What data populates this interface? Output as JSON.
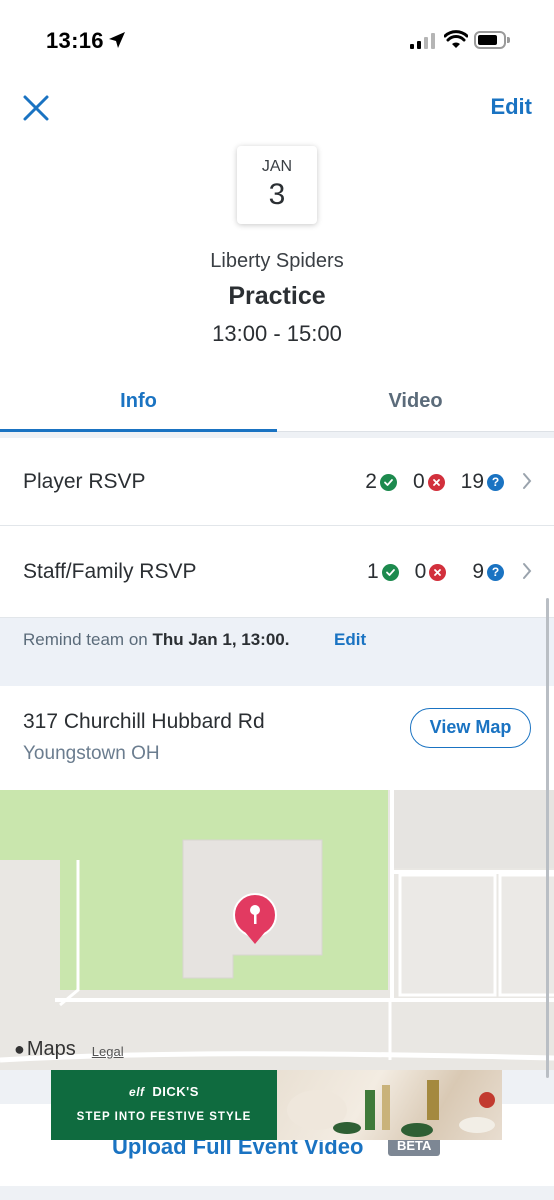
{
  "status_bar": {
    "time": "13:16"
  },
  "nav": {
    "edit_label": "Edit"
  },
  "event": {
    "month": "JAN",
    "day": "3",
    "team": "Liberty Spiders",
    "type": "Practice",
    "time": "13:00 - 15:00"
  },
  "tabs": [
    {
      "label": "Info",
      "active": true
    },
    {
      "label": "Video",
      "active": false
    }
  ],
  "player_rsvp": {
    "label": "Player RSVP",
    "yes": "2",
    "no": "0",
    "maybe": "19"
  },
  "staff_rsvp": {
    "label": "Staff/Family RSVP",
    "yes": "1",
    "no": "0",
    "maybe": "9"
  },
  "remind": {
    "prefix": "Remind team on",
    "datetime": "Thu Jan 1, 13:00.",
    "edit_label": "Edit"
  },
  "location": {
    "line1": "317 Churchill Hubbard Rd",
    "line2": "Youngstown OH",
    "view_map_label": "View Map"
  },
  "map": {
    "brand": "Maps",
    "legal": "Legal"
  },
  "ad": {
    "logo_text": "elf",
    "brand": "DICK'S",
    "tagline": "STEP INTO FESTIVE STYLE"
  },
  "upload": {
    "label": "Upload Full Event Video",
    "badge": "BETA"
  },
  "colors": {
    "accent": "#1a73c2",
    "yes": "#1d8a4e",
    "no": "#d2303c",
    "ad_green": "#0f6b3f"
  }
}
